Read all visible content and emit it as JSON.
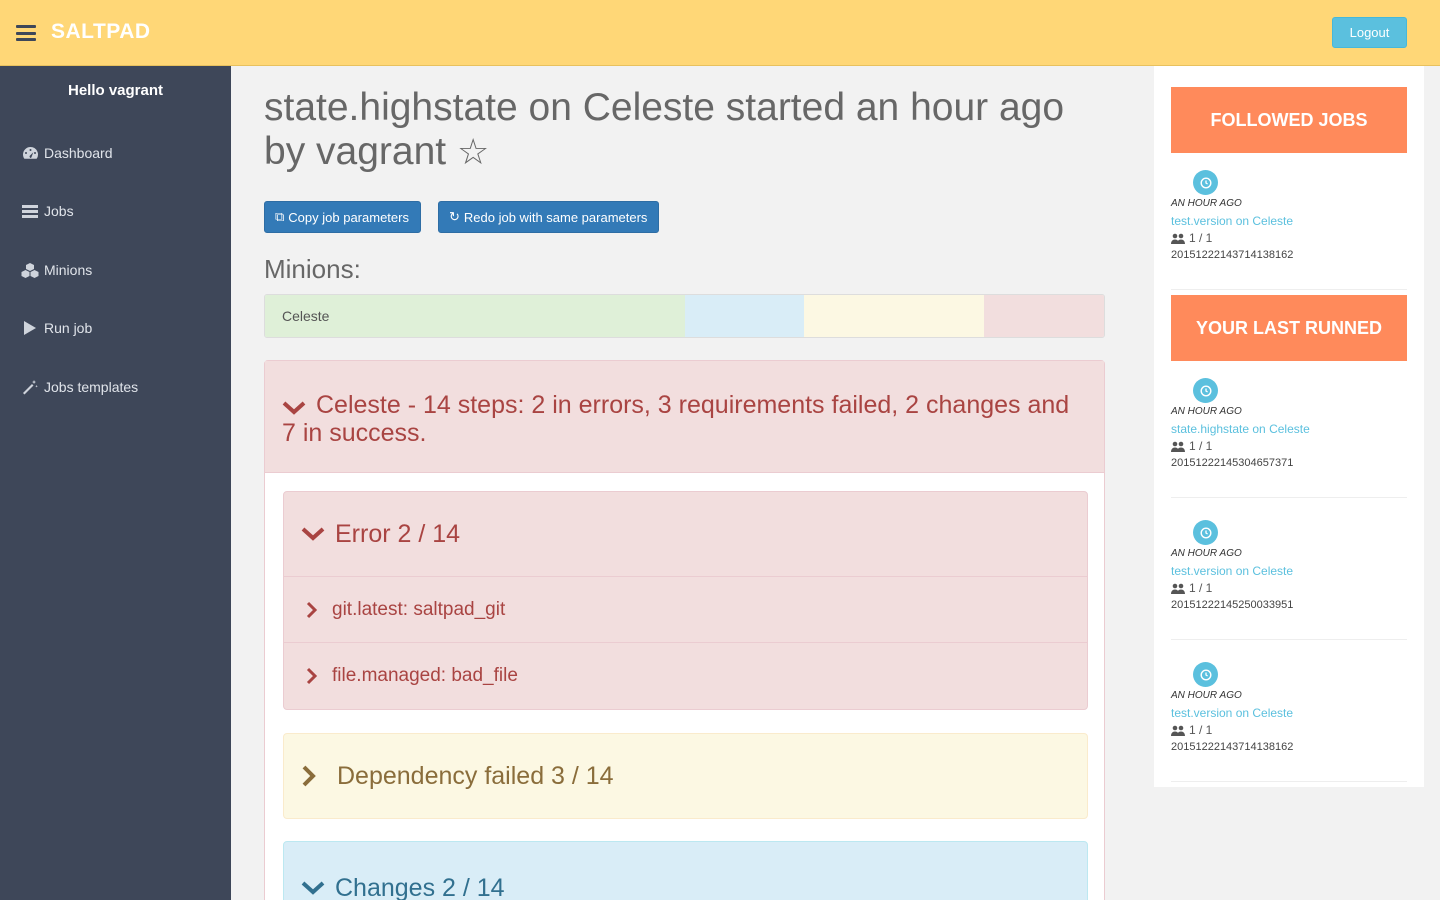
{
  "header": {
    "brand": "SALTPAD",
    "logout_label": "Logout"
  },
  "sidebar": {
    "greeting": "Hello vagrant",
    "items": [
      {
        "label": "Dashboard",
        "icon": "dashboard-icon"
      },
      {
        "label": "Jobs",
        "icon": "tasks-icon"
      },
      {
        "label": "Minions",
        "icon": "cubes-icon"
      },
      {
        "label": "Run job",
        "icon": "play-icon"
      },
      {
        "label": "Jobs templates",
        "icon": "magic-wand-icon"
      }
    ]
  },
  "main": {
    "title": "state.highstate on Celeste started an hour ago by vagrant",
    "copy_button": "Copy job parameters",
    "redo_button": "Redo job with same parameters",
    "minions_heading": "Minions:",
    "minion_bar": {
      "name": "Celeste",
      "segments": [
        {
          "status": "success",
          "count": 7,
          "color": "#dff0d8"
        },
        {
          "status": "changes",
          "count": 2,
          "color": "#d9edf7"
        },
        {
          "status": "requirements failed",
          "count": 3,
          "color": "#fcf8e3"
        },
        {
          "status": "errors",
          "count": 2,
          "color": "#f2dede"
        }
      ]
    },
    "summary": "Celeste - 14 steps: 2 in errors, 3 requirements failed, 2 changes and 7 in success.",
    "groups": {
      "error": {
        "title": "Error 2 / 14",
        "items": [
          "git.latest: saltpad_git",
          "file.managed: bad_file"
        ]
      },
      "dependency": {
        "title": "Dependency failed 3 / 14"
      },
      "changes": {
        "title": "Changes 2 / 14"
      }
    }
  },
  "right": {
    "followed_title": "FOLLOWED JOBS",
    "last_title": "YOUR LAST RUNNED",
    "followed": [
      {
        "when": "AN HOUR AGO",
        "link": "test.version on Celeste",
        "count": "1 / 1",
        "jid": "20151222143714138162"
      }
    ],
    "last": [
      {
        "when": "AN HOUR AGO",
        "link": "state.highstate on Celeste",
        "count": "1 / 1",
        "jid": "20151222145304657371"
      },
      {
        "when": "AN HOUR AGO",
        "link": "test.version on Celeste",
        "count": "1 / 1",
        "jid": "20151222145250033951"
      },
      {
        "when": "AN HOUR AGO",
        "link": "test.version on Celeste",
        "count": "1 / 1",
        "jid": "20151222143714138162"
      }
    ]
  },
  "colors": {
    "topbar": "#ffd777",
    "sidebar": "#3e4759",
    "primary": "#337ab7",
    "info": "#5bc0de",
    "orange": "#ff8a5b",
    "danger_text": "#a94442"
  }
}
